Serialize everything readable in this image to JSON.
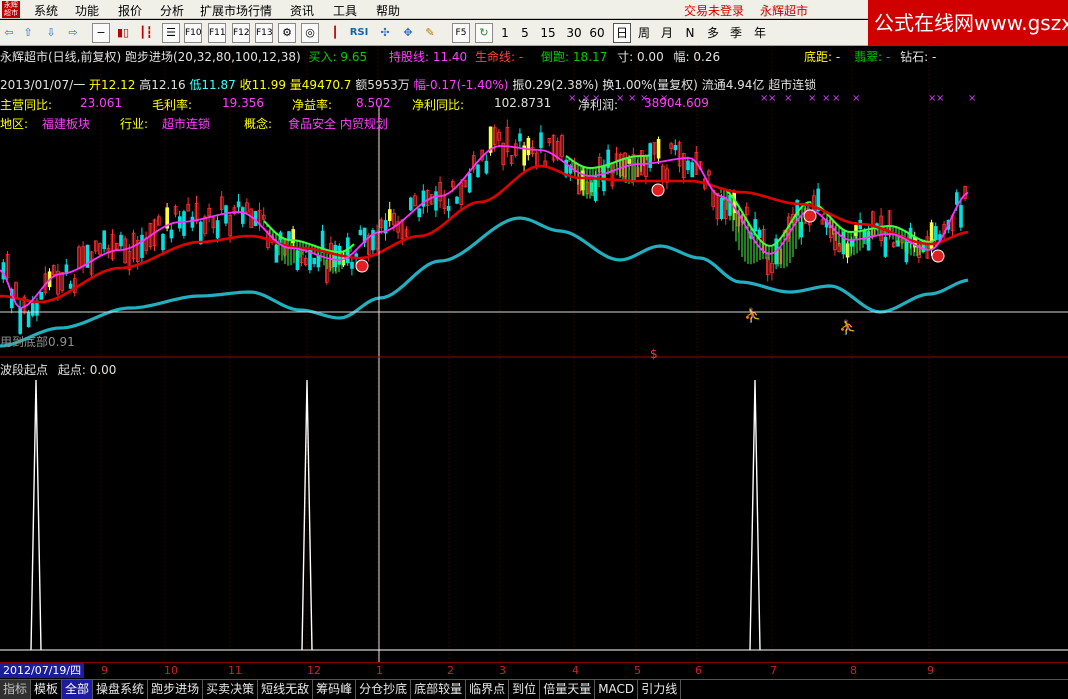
{
  "menu": {
    "logo": "永辉\n超市",
    "items": [
      "系统",
      "功能",
      "报价",
      "分析",
      "扩展市场行情",
      "资讯",
      "工具",
      "帮助"
    ],
    "status_trade": "交易未登录",
    "status_stock": "永辉超市"
  },
  "watermark": "公式在线网www.gszx.com.cn",
  "toolbar": {
    "icon_names": [
      "back-icon",
      "up-icon",
      "down-icon",
      "forward-icon",
      "minus-icon",
      "bar-chart-icon",
      "candle-icon",
      "menu-list-icon",
      "f10-icon",
      "f11-icon",
      "f12-icon",
      "f13-icon",
      "gear-icon",
      "indicator-icon",
      "search-icon"
    ],
    "rsi_label": "RSI",
    "f5_label": "F5",
    "periods": [
      "1",
      "5",
      "15",
      "30",
      "60",
      "日",
      "周",
      "月",
      "N",
      "多",
      "季",
      "年"
    ],
    "selected_period": "日"
  },
  "info": {
    "title": "永辉超市(日线,前复权) 跑步进场(20,32,80,100,12,38)",
    "buy_label": "买入:",
    "buy_value": "9.65",
    "hold_label": "持股线:",
    "hold_value": "11.40",
    "life_label": "生命线:",
    "life_value": "-",
    "fall_label": "倒跑:",
    "fall_value": "18.17",
    "inch_label": "寸:",
    "inch_value": "0.00",
    "amp_label": "幅:",
    "amp_value": "0.26",
    "bottom_label": "底距:",
    "bottom_value": "-",
    "emerald_label": "翡翠:",
    "emerald_value": "-",
    "diamond_label": "钻石:",
    "diamond_value": "-"
  },
  "quote": {
    "date": "2013/01/07/一",
    "open": "开12.12",
    "high": "高12.16",
    "low": "低11.87",
    "close": "收11.99",
    "volume": "量49470.7",
    "amount": "额5953万",
    "change": "幅-0.17(-1.40%)",
    "amplitude": "振0.29(2.38%)",
    "turnover": "换1.00%(量复权)",
    "float": "流通4.94亿",
    "concept": "超市连锁"
  },
  "fundamentals": {
    "revenue_label": "主营同比:",
    "revenue_value": "23.061",
    "gross_label": "毛利率:",
    "gross_value": "19.356",
    "roe_label": "净益率:",
    "roe_value": "8.502",
    "profit_yoy_label": "净利同比:",
    "profit_yoy_value": "102.8731",
    "net_label": "净利润:",
    "net_value": "38904.609"
  },
  "sector": {
    "region_label": "地区:",
    "region_value": "福建板块",
    "industry_label": "行业:",
    "industry_value": "超市连锁",
    "concept_label": "概念:",
    "concept_value": "食品安全 内贸规划"
  },
  "overlay_text": "用到底部0.91",
  "lower_panel": {
    "title": "波段起点",
    "value_label": "起点:",
    "value": "0.00"
  },
  "chart_data": {
    "type": "candlestick",
    "price_at_horizontal_line": 9.65,
    "spike_signal_positions": [
      1,
      2,
      3
    ],
    "spike_value": 1,
    "marker_symbol": "$",
    "x_ticks": [
      "9",
      "10",
      "11",
      "12",
      "1",
      "2",
      "3",
      "4",
      "5",
      "6",
      "7",
      "8",
      "9"
    ]
  },
  "date_bar": {
    "current": "2012/07/19/四"
  },
  "colors": {
    "up": "#ff3030",
    "down": "#00e0e0",
    "ma_red": "#e00000",
    "ma_magenta": "#ff30ff",
    "ma_cyan": "#20b0c0",
    "ribbon": "#40ff40",
    "grid": "#5a0000"
  },
  "tabs": [
    "指标",
    "模板",
    "全部",
    "操盘系统",
    "跑步进场",
    "买卖决策",
    "短线无敌",
    "筹码峰",
    "分仓抄底",
    "底部较量",
    "临界点",
    "到位",
    "倍量天量",
    "MACD",
    "引力线"
  ],
  "active_tab": "全部"
}
